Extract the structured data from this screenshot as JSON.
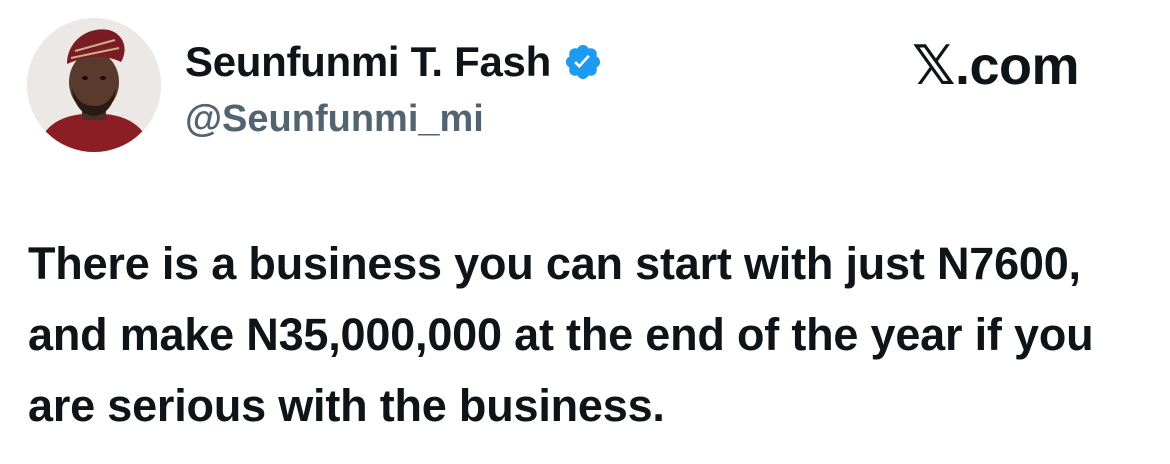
{
  "author": {
    "display_name": "Seunfunmi T. Fash",
    "handle": "@Seunfunmi_mi",
    "verified_icon": "verified-badge-icon",
    "avatar": "profile-photo"
  },
  "brand": {
    "label": "𝕏.com"
  },
  "tweet": {
    "text": "There is a business you can start with just N7600, and make N35,000,000 at the end of the year if you are serious with the business."
  },
  "colors": {
    "text": "#0f1419",
    "handle": "#536471",
    "verified": "#1d9bf0",
    "background": "#ffffff"
  }
}
